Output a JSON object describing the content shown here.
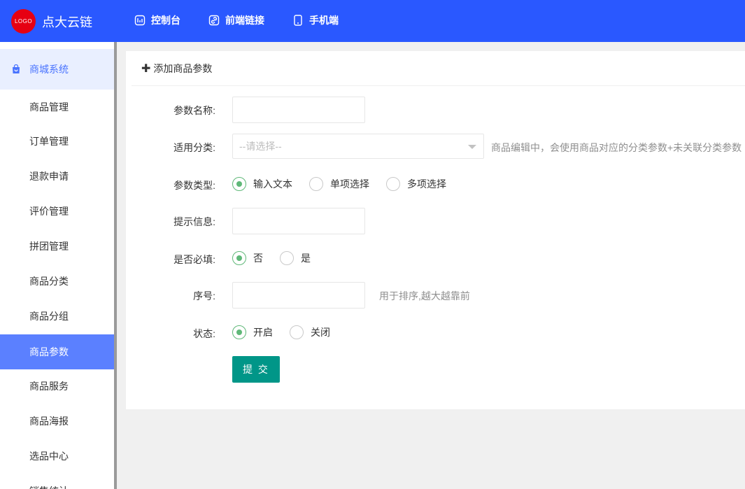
{
  "header": {
    "logo_text": "LOGO",
    "brand": "点大云链",
    "nav": [
      {
        "label": "控制台",
        "icon": "dashboard-icon"
      },
      {
        "label": "前端链接",
        "icon": "link-icon"
      },
      {
        "label": "手机端",
        "icon": "mobile-icon"
      }
    ],
    "accent_color": "#2a58ff",
    "logo_color": "#e60012"
  },
  "sidebar": {
    "section": {
      "label": "商城系统",
      "icon": "bag-icon"
    },
    "items": [
      {
        "label": "商品管理"
      },
      {
        "label": "订单管理"
      },
      {
        "label": "退款申请"
      },
      {
        "label": "评价管理"
      },
      {
        "label": "拼团管理"
      },
      {
        "label": "商品分类"
      },
      {
        "label": "商品分组"
      },
      {
        "label": "商品参数",
        "active": true
      },
      {
        "label": "商品服务"
      },
      {
        "label": "商品海报"
      },
      {
        "label": "选品中心"
      },
      {
        "label": "销售统计"
      }
    ],
    "active_color": "#5b80ff"
  },
  "panel": {
    "title": "添加商品参数",
    "form": {
      "name_label": "参数名称:",
      "name_value": "",
      "category_label": "适用分类:",
      "category_placeholder": "--请选择--",
      "category_hint": "商品编辑中，会使用商品对应的分类参数+未关联分类参数",
      "type_label": "参数类型:",
      "type_options": [
        "输入文本",
        "单项选择",
        "多项选择"
      ],
      "type_selected": "输入文本",
      "tip_label": "提示信息:",
      "tip_value": "",
      "required_label": "是否必填:",
      "required_options": [
        "否",
        "是"
      ],
      "required_selected": "否",
      "order_label": "序号:",
      "order_value": "",
      "order_hint": "用于排序,越大越靠前",
      "status_label": "状态:",
      "status_options": [
        "开启",
        "关闭"
      ],
      "status_selected": "开启",
      "submit_label": "提 交"
    },
    "radio_color": "#5fb878",
    "submit_color": "#009688"
  }
}
